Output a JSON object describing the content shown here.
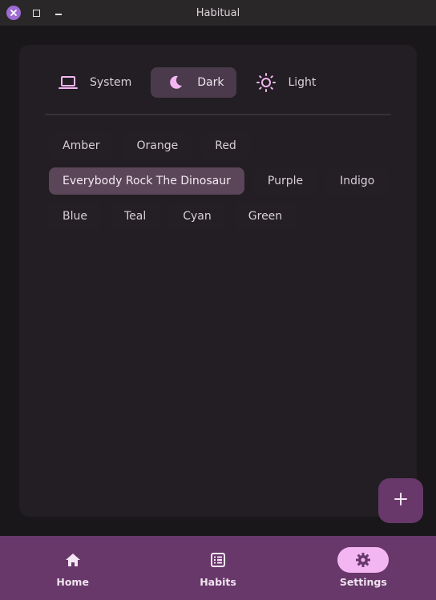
{
  "window": {
    "title": "Habitual"
  },
  "theme": {
    "options": [
      {
        "label": "System",
        "icon": "laptop-icon",
        "selected": false
      },
      {
        "label": "Dark",
        "icon": "moon-icon",
        "selected": true
      },
      {
        "label": "Light",
        "icon": "sun-icon",
        "selected": false
      }
    ]
  },
  "accents": {
    "rows": [
      [
        {
          "label": "Amber"
        },
        {
          "label": "Orange"
        },
        {
          "label": "Red"
        }
      ],
      [
        {
          "label": "Everybody Rock The Dinosaur",
          "selected": true
        },
        {
          "label": "Purple"
        },
        {
          "label": "Indigo"
        }
      ],
      [
        {
          "label": "Blue"
        },
        {
          "label": "Teal"
        },
        {
          "label": "Cyan"
        },
        {
          "label": "Green"
        }
      ]
    ]
  },
  "fab": {
    "icon": "plus-icon"
  },
  "nav": {
    "items": [
      {
        "label": "Home",
        "icon": "home-icon",
        "active": false
      },
      {
        "label": "Habits",
        "icon": "list-icon",
        "active": false
      },
      {
        "label": "Settings",
        "icon": "gear-icon",
        "active": true
      }
    ]
  },
  "colors": {
    "accent": "#f3b6f2",
    "nav_background": "#68386b",
    "selected_chip": "#5a4559",
    "window_background": "#1a171b"
  }
}
